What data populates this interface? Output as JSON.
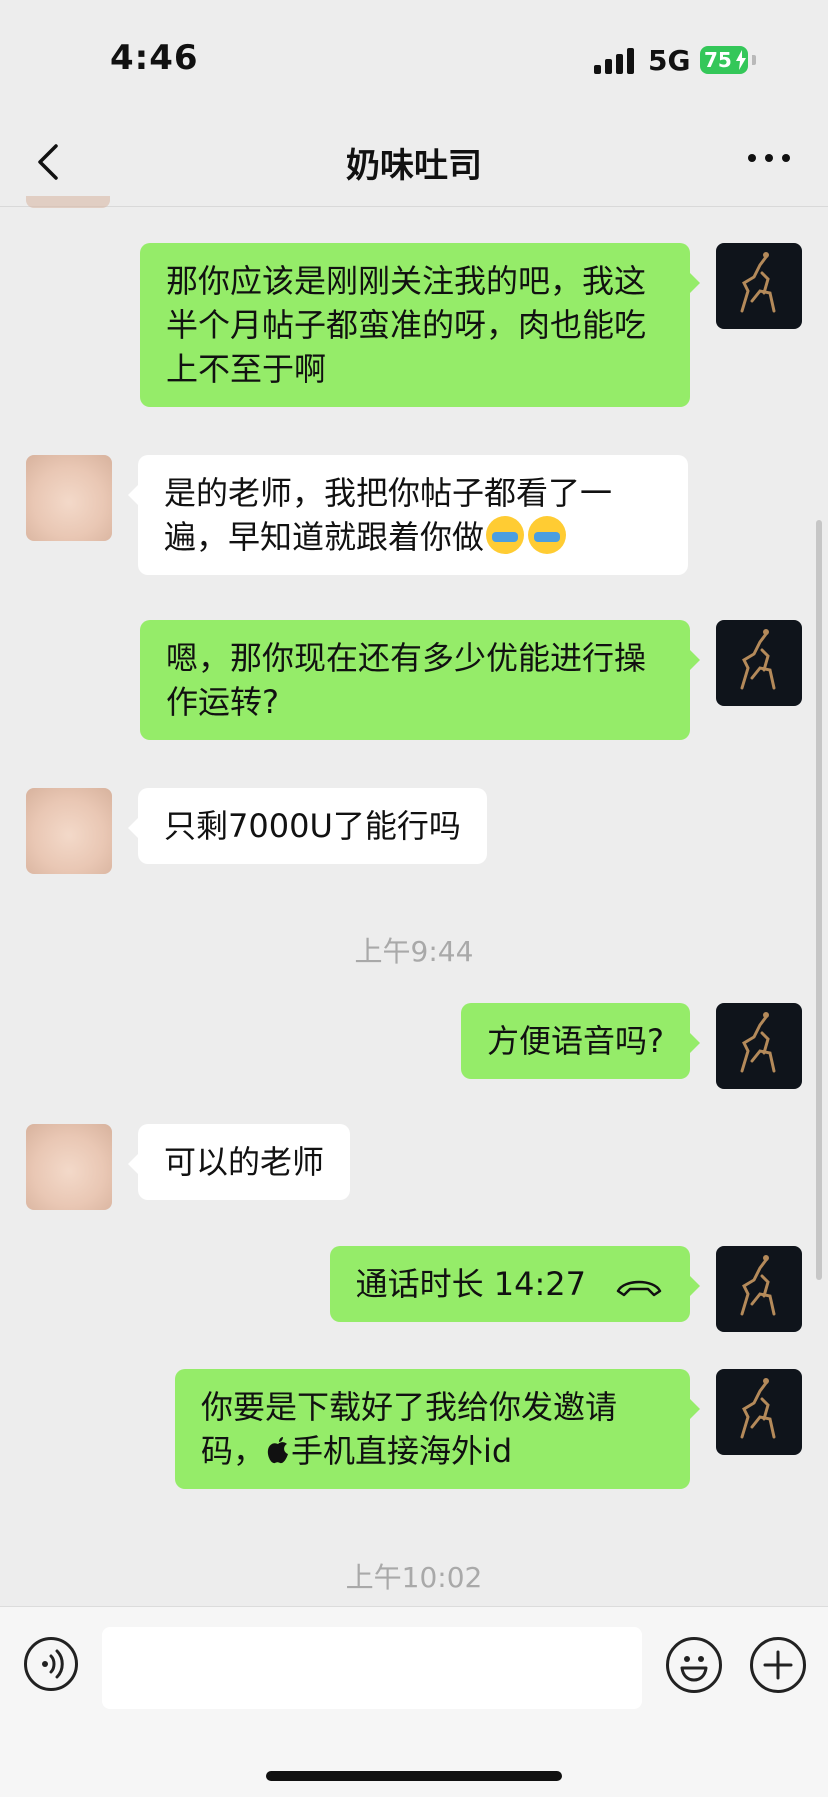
{
  "status_bar": {
    "time": "4:46",
    "network": "5G",
    "battery": "75"
  },
  "header": {
    "title": "奶味吐司"
  },
  "messages": [
    {
      "text": "那你应该是刚刚关注我的吧，我这半个月帖子都蛮准的呀，肉也能吃上不至于啊"
    },
    {
      "text": "是的老师，我把你帖子都看了一遍，早知道就跟着你做"
    },
    {
      "text": "嗯，那你现在还有多少优能进行操作运转?"
    },
    {
      "text": "只剩7000U了能行吗"
    },
    {
      "text": "方便语音吗?"
    },
    {
      "text": "可以的老师"
    },
    {
      "text": "通话时长 14:27"
    },
    {
      "text_before": "你要是下载好了我给你发邀请码，",
      "text_after": "手机直接海外id"
    }
  ],
  "timestamps": [
    "上午9:44",
    "上午10:02"
  ],
  "icons": {
    "back": "chevron-left-icon",
    "more": "more-dots-icon",
    "cry_emoji": "loudly-crying-face-emoji",
    "apple": "apple-logo-icon",
    "call": "phone-hangup-icon",
    "voice": "voice-input-icon",
    "emoji": "emoji-smile-icon",
    "plus": "plus-icon"
  },
  "colors": {
    "sent_bubble": "#95ec69",
    "received_bubble": "#ffffff",
    "background": "#ededed",
    "battery": "#34c759"
  }
}
